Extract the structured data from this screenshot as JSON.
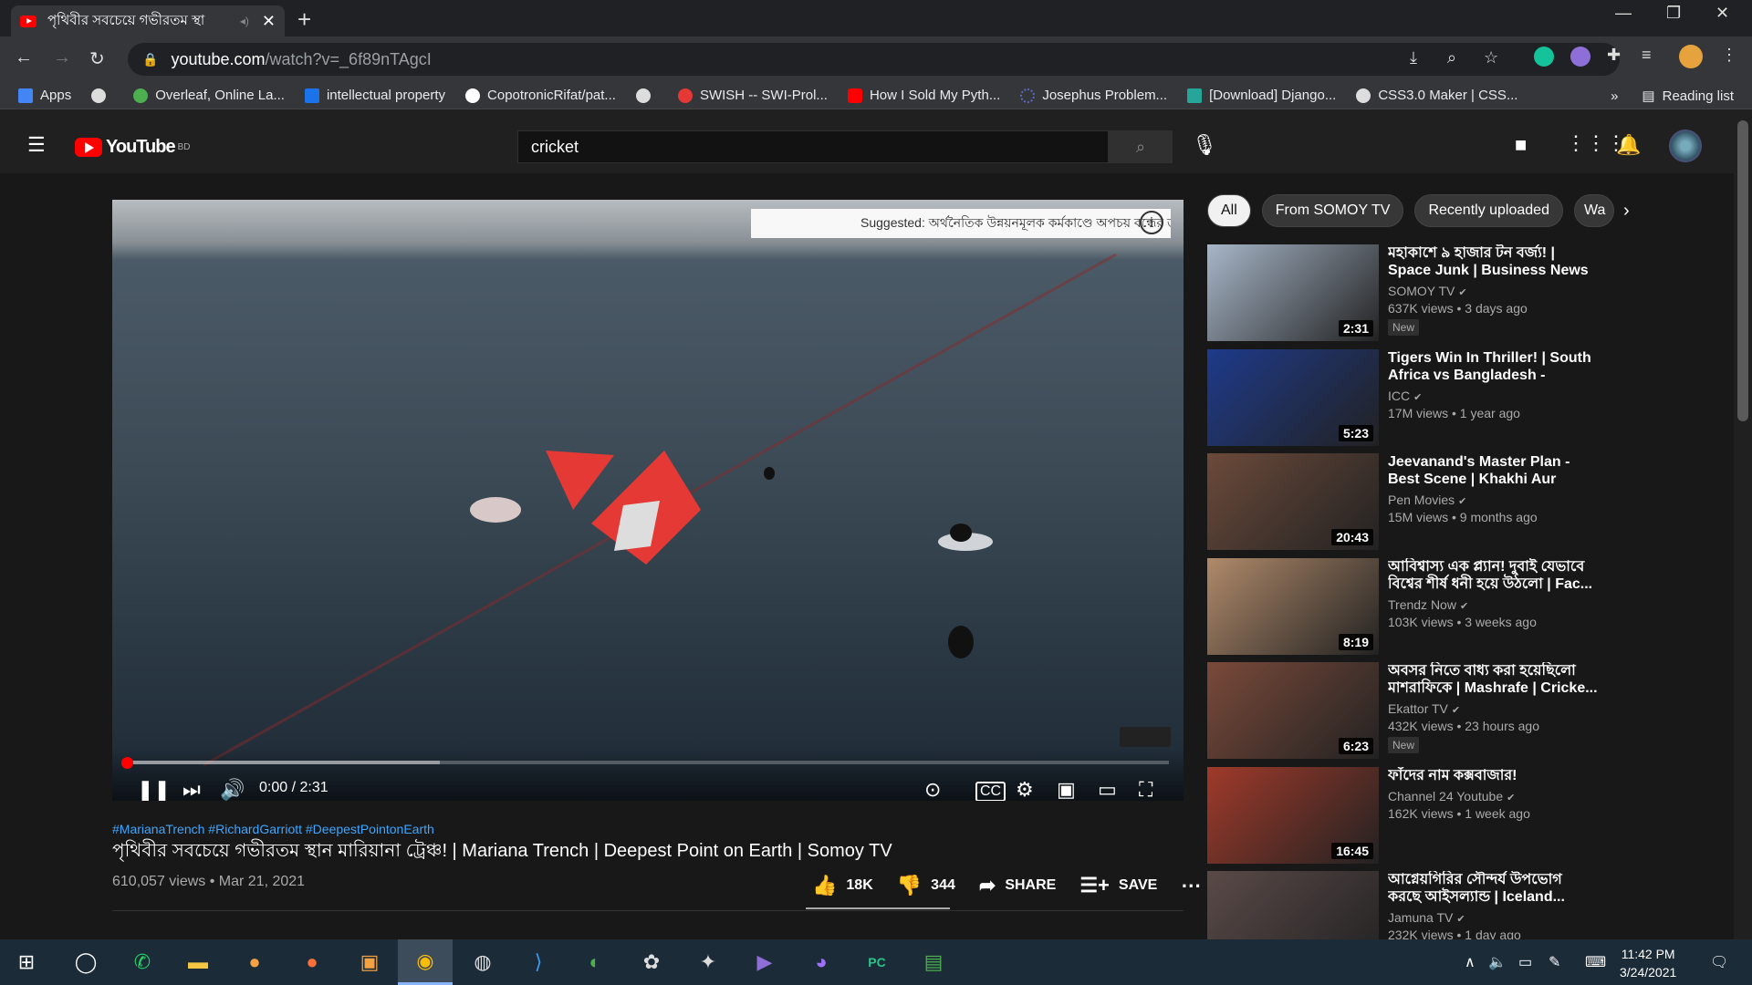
{
  "browser": {
    "tab_title": "পৃথিবীর সবচেয়ে গভীরতম স্থা",
    "url_host": "youtube.com",
    "url_path": "/watch?v=_6f89nTAgcI",
    "bookmarks": [
      {
        "label": "Apps",
        "color": "#4285f4"
      },
      {
        "label": "",
        "color": "#ddd"
      },
      {
        "label": "Overleaf, Online La...",
        "color": "#4caf50"
      },
      {
        "label": "intellectual property",
        "color": "#1a73e8"
      },
      {
        "label": "CopotronicRifat/pat...",
        "color": "#fff"
      },
      {
        "label": "",
        "color": "#ddd"
      },
      {
        "label": "SWISH -- SWI-Prol...",
        "color": "#e53935"
      },
      {
        "label": "How I Sold My Pyth...",
        "color": "#ff0000"
      },
      {
        "label": "Josephus Problem...",
        "color": "#5c6bc0"
      },
      {
        "label": "[Download] Django...",
        "color": "#26a69a"
      },
      {
        "label": "CSS3.0 Maker | CSS...",
        "color": "#ddd"
      }
    ],
    "reading_list": "Reading list"
  },
  "youtube": {
    "logo_text": "YouTube",
    "logo_country": "BD",
    "search_value": "cricket"
  },
  "player": {
    "suggested": "Suggested: অর্থনৈতিক উন্নয়নমূলক কর্মকাণ্ডে অপচয় বন্ধের তাগিদ অ...",
    "time": "0:00 / 2:31",
    "progress_played": 0.0,
    "progress_buffered": 0.3
  },
  "video": {
    "tags": "#MarianaTrench #RichardGarriott #DeepestPointonEarth",
    "title": "পৃথিবীর সবচেয়ে গভীরতম স্থান মারিয়ানা ট্রেঞ্চ! | Mariana Trench | Deepest Point on Earth | Somoy TV",
    "meta": "610,057 views • Mar 21, 2021",
    "likes": "18K",
    "dislikes": "344",
    "share": "SHARE",
    "save": "SAVE"
  },
  "chips": [
    "All",
    "From SOMOY TV",
    "Recently uploaded",
    "Wa"
  ],
  "recommendations": [
    {
      "title": "মহাকাশে ৯ হাজার টন বর্জ্য! | Space Junk | Business News |...",
      "channel": "SOMOY TV",
      "stats": "637K views • 3 days ago",
      "duration": "2:31",
      "badge": "New",
      "color": "#a7b6c8"
    },
    {
      "title": "Tigers Win In Thriller! | South Africa vs Bangladesh - Match...",
      "channel": "ICC",
      "stats": "17M views • 1 year ago",
      "duration": "5:23",
      "badge": "",
      "color": "#1e3a8a"
    },
    {
      "title": "Jeevanand's Master Plan - Best Scene | Khakhi Aur Khiladi |...",
      "channel": "Pen Movies",
      "stats": "15M views • 9 months ago",
      "duration": "20:43",
      "badge": "",
      "color": "#6b4a3a"
    },
    {
      "title": "আবিশ্বাস্য এক প্ল্যান! দুবাই যেভাবে বিশ্বের শীর্ষ ধনী হয়ে উঠলো | Fac...",
      "channel": "Trendz Now",
      "stats": "103K views • 3 weeks ago",
      "duration": "8:19",
      "badge": "",
      "color": "#b08a6a"
    },
    {
      "title": "অবসর নিতে বাধ্য করা হয়েছিলো মাশরাফিকে | Mashrafe | Cricke...",
      "channel": "Ekattor TV",
      "stats": "432K views • 23 hours ago",
      "duration": "6:23",
      "badge": "New",
      "color": "#7a4a3a"
    },
    {
      "title": "ফাঁদের নাম কক্সবাজার!",
      "channel": "Channel 24 Youtube",
      "stats": "162K views • 1 week ago",
      "duration": "16:45",
      "badge": "",
      "color": "#a03a2a"
    },
    {
      "title": "আগ্নেয়গিরির সৌন্দর্য উপভোগ করছে আইসল্যান্ড | Iceland...",
      "channel": "Jamuna TV",
      "stats": "232K views • 1 day ago",
      "duration": "",
      "badge": "",
      "color": "#5a4a48"
    }
  ],
  "clock": {
    "time": "11:42 PM",
    "date": "3/24/2021"
  }
}
